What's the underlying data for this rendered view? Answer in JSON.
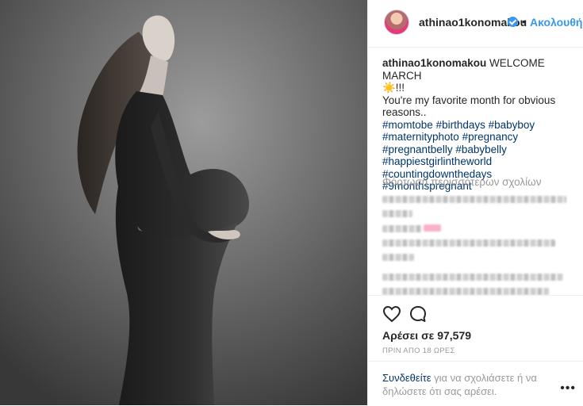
{
  "post": {
    "username": "athinao1konomakou",
    "follow_label": "Ακολουθήστε",
    "dot": "•",
    "caption_username": "athinao1konomakou",
    "caption_line1": " WELCOME MARCH",
    "caption_line2": "☀️!!!",
    "caption_line3": "You're my favorite month for obvious reasons..",
    "hashtags_line1": [
      "#momtobe",
      "#birthdays",
      "#babyboy"
    ],
    "hashtags_line2": [
      "#maternityphoto",
      "#pregnancy"
    ],
    "hashtags_line3": [
      "#pregnantbelly",
      "#babybelly"
    ],
    "hashtags_line4": [
      "#happiestgirlintheworld"
    ],
    "hashtags_line5": [
      "#countingdownthedays",
      "#9monthspregnant"
    ],
    "load_more": "Φόρτωση περισσότερων σχολίων",
    "likes": "Αρέσει σε 97,579",
    "timestamp": "ΠΡΙΝ ΑΠΟ 18 ΩΡΕΣ",
    "login_link": "Συνδεθείτε",
    "login_text": " για να σχολιάσετε ή να δηλώσετε ότι σας αρέσει.",
    "more_options": "•••"
  },
  "icons": {
    "like": "heart-outline-icon",
    "comment": "comment-bubble-icon",
    "verified": "verified-badge-icon"
  },
  "colors": {
    "link_blue": "#3897f0",
    "hashtag": "#003569",
    "muted": "#999999"
  }
}
